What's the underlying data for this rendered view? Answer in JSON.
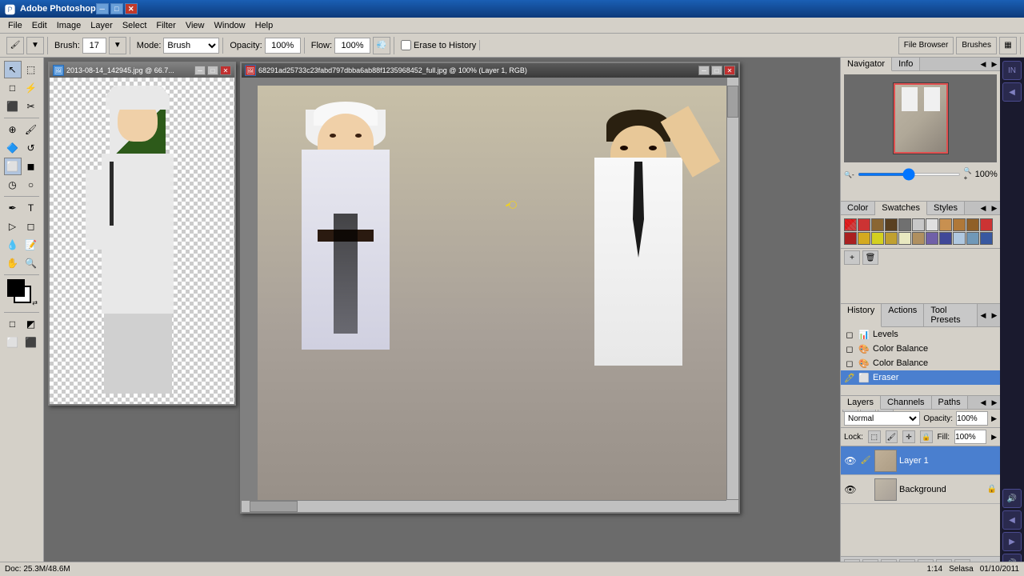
{
  "app": {
    "title": "Adobe Photoshop",
    "icon": "PS"
  },
  "titlebar": {
    "title": "Adobe Photoshop",
    "minimize": "─",
    "maximize": "□",
    "close": "✕"
  },
  "menubar": {
    "items": [
      "File",
      "Edit",
      "Image",
      "Layer",
      "Select",
      "Filter",
      "View",
      "Window",
      "Help"
    ]
  },
  "toolbar": {
    "brush_label": "Brush:",
    "brush_size": "17",
    "mode_label": "Mode:",
    "mode_value": "Brush",
    "opacity_label": "Opacity:",
    "opacity_value": "100%",
    "flow_label": "Flow:",
    "flow_value": "100%",
    "erase_to_history": "Erase to History",
    "file_browser": "File Browser",
    "brushes": "Brushes"
  },
  "doc1": {
    "title": "2013-08-14_142945.jpg @ 66.7...",
    "icon": "🖼",
    "zoom": "66.7%"
  },
  "doc2": {
    "title": "68291ad25733c23fabd797dbba6ab88f1235968452_full.jpg @ 100% (Layer 1, RGB)",
    "zoom": "100%",
    "layer": "Layer 1",
    "mode": "RGB"
  },
  "navigator": {
    "title": "Navigator",
    "info_tab": "Info",
    "zoom_value": "100%",
    "close": "▶"
  },
  "color_panel": {
    "color_tab": "Color",
    "swatches_tab": "Swatches",
    "styles_tab": "Styles"
  },
  "swatches": {
    "colors": [
      "#ff0000",
      "#ffffff",
      "#c8a060",
      "#a06030",
      "#808080",
      "#404040",
      "#d4a870",
      "#c09050",
      "#a07040",
      "#e04040",
      "#c03030",
      "#d4b040",
      "#c0a030",
      "#e8e8e8",
      "#b08050",
      "#8060c0",
      "#5050a0",
      "#c0d0e8",
      "#80a0c0",
      "#4060a0"
    ]
  },
  "history": {
    "title": "History",
    "actions_tab": "Actions",
    "tool_presets_tab": "Tool Presets",
    "items": [
      {
        "name": "Levels",
        "icon": "📊",
        "active": false
      },
      {
        "name": "Color Balance",
        "icon": "🎨",
        "active": false
      },
      {
        "name": "Color Balance",
        "icon": "🎨",
        "active": false
      },
      {
        "name": "Eraser",
        "icon": "🖊",
        "active": true
      }
    ],
    "close": "▶"
  },
  "layers": {
    "title": "Layers",
    "channels_tab": "Channels",
    "paths_tab": "Paths",
    "blend_mode": "Normal",
    "opacity_label": "Opacity:",
    "opacity_value": "100%",
    "fill_label": "Fill:",
    "fill_value": "100%",
    "lock_label": "Lock:",
    "items": [
      {
        "name": "Layer 1",
        "active": true,
        "locked": false,
        "visible": true
      },
      {
        "name": "Background",
        "active": false,
        "locked": true,
        "visible": true
      }
    ]
  },
  "statusbar": {
    "info": "IN ◀",
    "time": "1:14",
    "date": "Selasa",
    "date2": "01/10/2011"
  },
  "right_chrome": {
    "buttons": [
      "🌐",
      "★",
      "🔊",
      "◀",
      "▶",
      "🔊",
      "⚙"
    ]
  },
  "swatch_detail": {
    "row1": [
      "#cc0000",
      "#ff3333",
      "#aa6622",
      "#7a5030",
      "#808080",
      "#c0c0c0",
      "#e0e0e0"
    ],
    "row2": [
      "#d4a060",
      "#c08040",
      "#906030",
      "#cc3333",
      "#aa2222",
      "#d4b030",
      "#f0f040"
    ],
    "row3": [
      "#c09840",
      "#e8e8d0",
      "#b08850",
      "#7060b0",
      "#4848a0",
      "#c0d4e8",
      "#80a0c0"
    ],
    "diag1": "#ff0000",
    "diag2": "#c85060"
  }
}
